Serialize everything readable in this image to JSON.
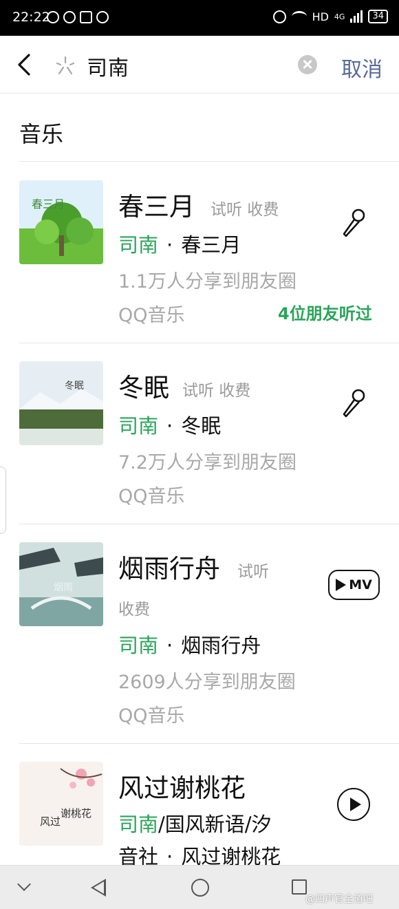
{
  "status_bar": {
    "time": "22:22",
    "network": "HD",
    "network_gen": "4G",
    "battery": "34"
  },
  "search": {
    "query": "司南",
    "cancel_label": "取消"
  },
  "section": {
    "title": "音乐"
  },
  "results": [
    {
      "title": "春三月",
      "tags": "试听 收费",
      "artist": "司南",
      "separator": "·",
      "song": "春三月",
      "shares": "1.1万人分享到朋友圈",
      "source": "QQ音乐",
      "friends": "4位朋友听过",
      "action": "mic-icon"
    },
    {
      "title": "冬眠",
      "tags": "试听 收费",
      "artist": "司南",
      "separator": "·",
      "song": "冬眠",
      "shares": "7.2万人分享到朋友圈",
      "source": "QQ音乐",
      "action": "mic-icon"
    },
    {
      "title": "烟雨行舟",
      "tag_first": "试听",
      "tag_second": "收费",
      "artist": "司南",
      "separator": "·",
      "song": "烟雨行舟",
      "shares": "2609人分享到朋友圈",
      "source": "QQ音乐",
      "mv_label": "MV",
      "action": "mv-icon"
    },
    {
      "title": "风过谢桃花",
      "artist": "司南",
      "artist_rest": "/国风新语/汐",
      "artist_line2": "音社",
      "separator": "·",
      "song": "风过谢桃花",
      "action": "play-icon"
    }
  ],
  "colors": {
    "accent_green": "#2aa45a",
    "link_blue": "#576b95",
    "muted_gray": "#a8a8a8"
  },
  "watermark": "@四声官全道吧"
}
